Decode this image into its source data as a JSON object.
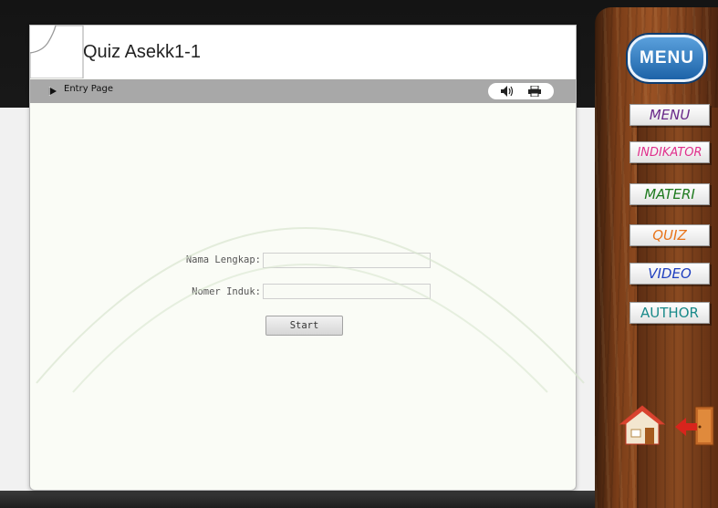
{
  "quiz": {
    "title": "Quiz Asekk1-1",
    "breadcrumb": "Entry Page",
    "sound_icon": "speaker-icon",
    "print_icon": "printer-icon"
  },
  "form": {
    "name_label": "Nama Lengkap:",
    "name_value": "",
    "id_label": "Nomer Induk:",
    "id_value": "",
    "start_label": "Start"
  },
  "sidebar": {
    "badge_label": "MENU",
    "items": [
      {
        "label": "MENU",
        "color": "#6a2a8a"
      },
      {
        "label": "INDIKATOR",
        "color": "#e0308c"
      },
      {
        "label": "MATERI",
        "color": "#1e7a1e"
      },
      {
        "label": "QUIZ",
        "color": "#e8741a"
      },
      {
        "label": "VIDEO",
        "color": "#1f3fbf"
      },
      {
        "label": "AUTHOR",
        "color": "#1a8a8a"
      }
    ],
    "home_icon": "house-icon",
    "exit_icon": "exit-door-icon"
  }
}
